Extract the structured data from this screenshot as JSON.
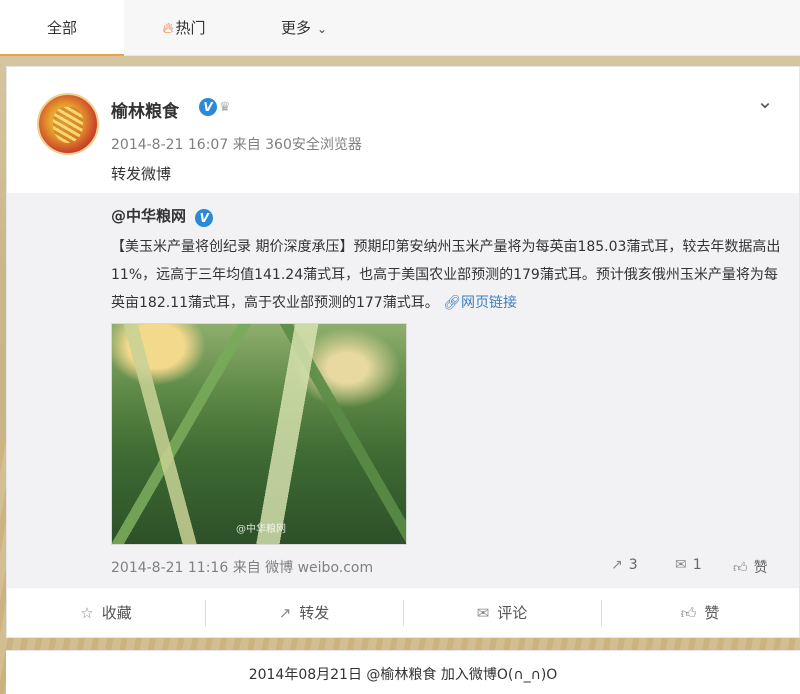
{
  "tabs": [
    {
      "label": "全部"
    },
    {
      "label": "热门",
      "icon": "fire-icon"
    },
    {
      "label": "更多",
      "icon": "chevron-down-icon"
    }
  ],
  "post": {
    "username": "榆林粮食",
    "verified_badge": "V",
    "timestamp": "2014-8-21 16:07",
    "source": "来自 360安全浏览器",
    "text": "转发微博"
  },
  "repost": {
    "username": "@中华粮网",
    "verified_badge": "V",
    "text": "【美玉米产量将创纪录 期价深度承压】预期印第安纳州玉米产量将为每英亩185.03蒲式耳，较去年数据高出11%，远高于三年均值141.24蒲式耳，也高于美国农业部预测的179蒲式耳。预计俄亥俄州玉米产量将为每英亩182.11蒲式耳，高于农业部预测的177蒲式耳。",
    "link_label": "网页链接",
    "image_watermark": "@中华粮网",
    "timestamp": "2014-8-21 11:16",
    "source": "来自 微博 weibo.com",
    "repost_count": "3",
    "comment_count": "1",
    "like_label": "赞"
  },
  "actions": {
    "favorite": "收藏",
    "repost": "转发",
    "comment": "评论",
    "like": "赞"
  },
  "footer": {
    "text": "2014年08月21日 @榆林粮食 加入微博O(∩_∩)O"
  },
  "colors": {
    "accent": "#f26a21",
    "link": "#3e7fc1",
    "verified": "#2b8ad8"
  }
}
